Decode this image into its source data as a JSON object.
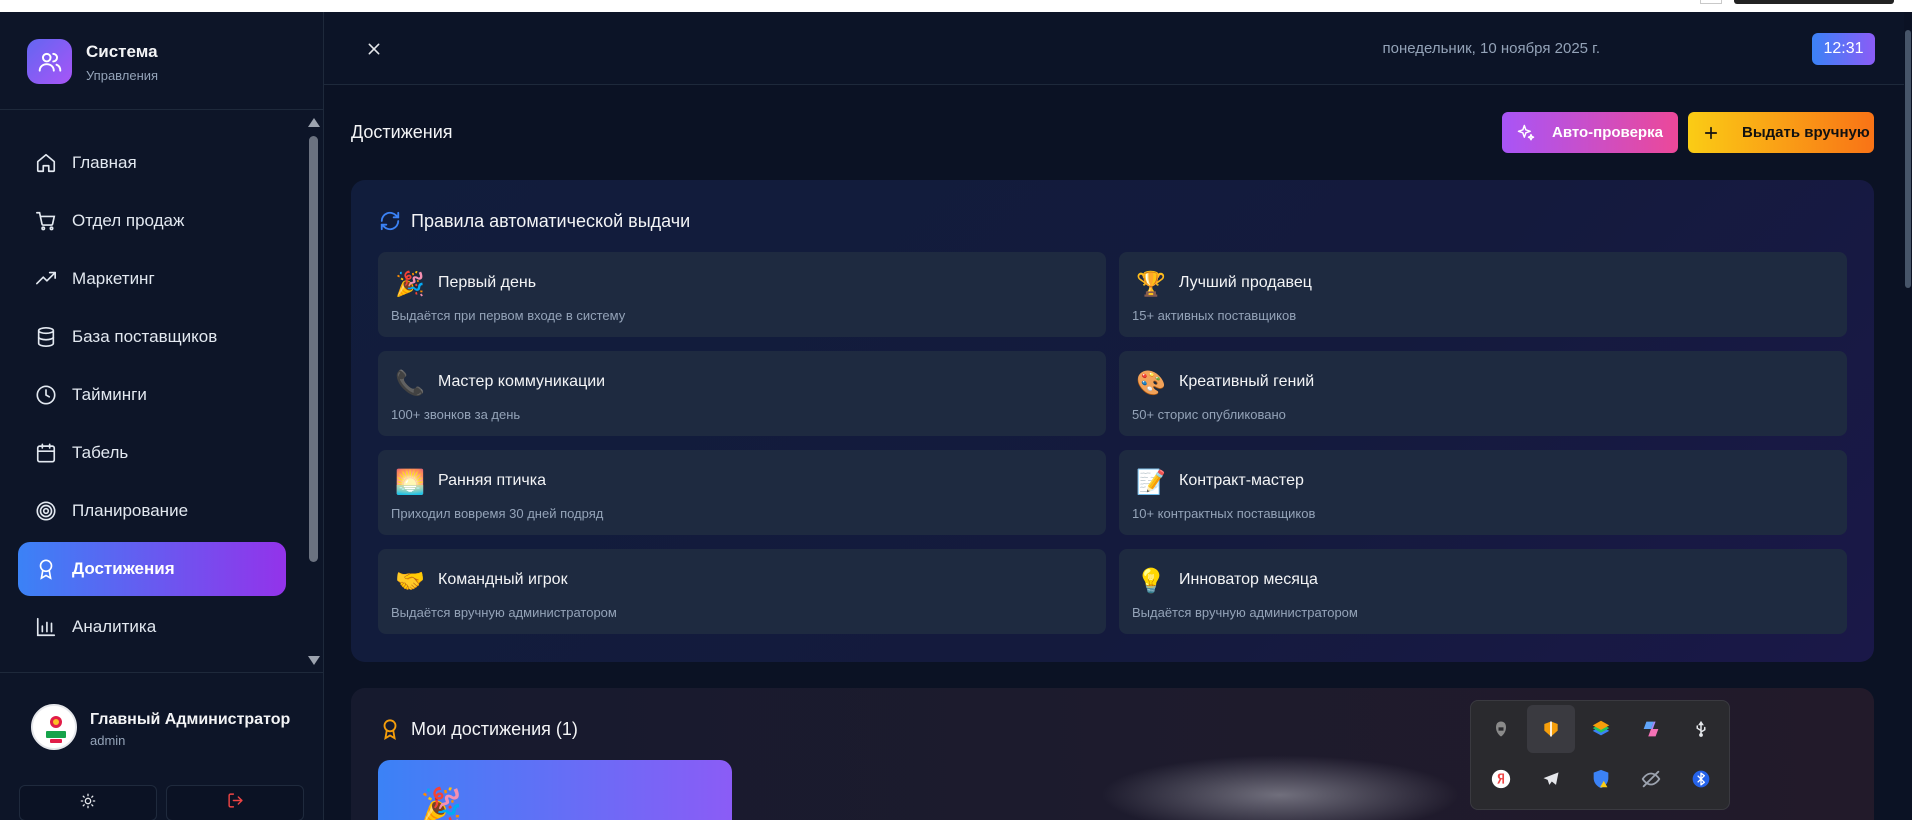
{
  "brand": {
    "title": "Система",
    "subtitle": "Управления"
  },
  "sidebar": {
    "items": [
      {
        "label": "Главная",
        "icon": "home-icon"
      },
      {
        "label": "Отдел продаж",
        "icon": "cart-icon"
      },
      {
        "label": "Маркетинг",
        "icon": "trending-up-icon"
      },
      {
        "label": "База поставщиков",
        "icon": "database-icon"
      },
      {
        "label": "Тайминги",
        "icon": "clock-icon"
      },
      {
        "label": "Табель",
        "icon": "calendar-icon"
      },
      {
        "label": "Планирование",
        "icon": "target-icon"
      },
      {
        "label": "Достижения",
        "icon": "award-icon",
        "active": true
      },
      {
        "label": "Аналитика",
        "icon": "bar-chart-icon"
      }
    ]
  },
  "user": {
    "name": "Главный Администратор",
    "role": "admin"
  },
  "header": {
    "date": "понедельник, 10 ноября 2025 г.",
    "time": "12:31"
  },
  "page": {
    "title": "Достижения",
    "auto_button": "Авто-проверка",
    "manual_button": "Выдать вручную"
  },
  "rules": {
    "title": "Правила автоматической выдачи",
    "items": [
      {
        "emoji": "🎉",
        "title": "Первый день",
        "desc": "Выдаётся при первом входе в систему"
      },
      {
        "emoji": "🏆",
        "title": "Лучший продавец",
        "desc": "15+ активных поставщиков"
      },
      {
        "emoji": "📞",
        "title": "Мастер коммуникации",
        "desc": "100+ звонков за день"
      },
      {
        "emoji": "🎨",
        "title": "Креативный гений",
        "desc": "50+ сторис опубликовано"
      },
      {
        "emoji": "🌅",
        "title": "Ранняя птичка",
        "desc": "Приходил вовремя 30 дней подряд"
      },
      {
        "emoji": "📝",
        "title": "Контракт-мастер",
        "desc": "10+ контрактных поставщиков"
      },
      {
        "emoji": "🤝",
        "title": "Командный игрок",
        "desc": "Выдаётся вручную администратором"
      },
      {
        "emoji": "💡",
        "title": "Инноватор месяца",
        "desc": "Выдаётся вручную администратором"
      }
    ]
  },
  "my_achievements": {
    "title": "Мои достижения (1)",
    "first_emoji": "🎉"
  },
  "tray": {
    "icons": [
      "gpu-icon",
      "app-icon",
      "bluestacks-icon",
      "copilot-icon",
      "usb-icon",
      "yandex-icon",
      "telegram-icon",
      "security-warning-icon",
      "hidden-eye-icon",
      "bluetooth-icon"
    ]
  },
  "colors": {
    "accent_from": "#3b82f6",
    "accent_to": "#9333ea",
    "auto_from": "#a855f7",
    "auto_to": "#ec4899",
    "manual_from": "#facc15",
    "manual_to": "#f97316"
  }
}
